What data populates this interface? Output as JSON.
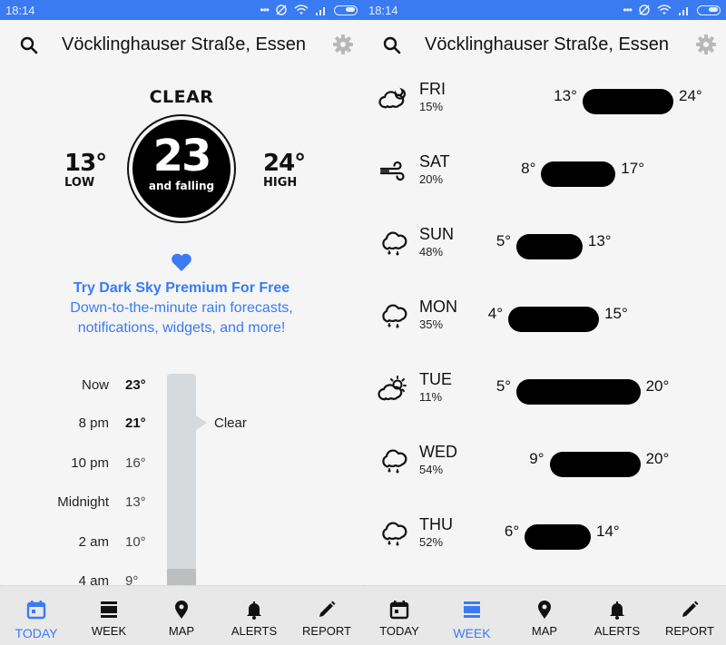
{
  "status_bar": {
    "time": "18:14",
    "color": "#3a7bf2"
  },
  "header": {
    "location": "Vöcklinghauser Straße, Essen",
    "search_icon": "search-icon",
    "settings_icon": "gear-icon"
  },
  "today": {
    "condition": "CLEAR",
    "current_temp": "23",
    "trend": "and falling",
    "low": {
      "value": "13°",
      "label": "LOW"
    },
    "high": {
      "value": "24°",
      "label": "HIGH"
    },
    "promo": {
      "icon": "heart-icon",
      "title": "Try Dark Sky Premium For Free",
      "line1": "Down-to-the-minute rain forecasts,",
      "line2": "notifications, widgets, and more!"
    },
    "hourly": [
      {
        "time": "Now",
        "temp": "23°",
        "bold": true
      },
      {
        "time": "8 pm",
        "temp": "21°",
        "bold": true
      },
      {
        "time": "10 pm",
        "temp": "16°",
        "bold": false
      },
      {
        "time": "Midnight",
        "temp": "13°",
        "bold": false
      },
      {
        "time": "2 am",
        "temp": "10°",
        "bold": false
      },
      {
        "time": "4 am",
        "temp": "9°",
        "bold": false
      }
    ],
    "timeline_label": "Clear"
  },
  "week": {
    "days": [
      {
        "day": "FRI",
        "precip": "15%",
        "low": 13,
        "high": 24,
        "low_label": "13°",
        "high_label": "24°",
        "icon": "partly-cloudy-night-icon"
      },
      {
        "day": "SAT",
        "precip": "20%",
        "low": 8,
        "high": 17,
        "low_label": "8°",
        "high_label": "17°",
        "icon": "wind-icon"
      },
      {
        "day": "SUN",
        "precip": "48%",
        "low": 5,
        "high": 13,
        "low_label": "5°",
        "high_label": "13°",
        "icon": "rain-icon"
      },
      {
        "day": "MON",
        "precip": "35%",
        "low": 4,
        "high": 15,
        "low_label": "4°",
        "high_label": "15°",
        "icon": "rain-icon"
      },
      {
        "day": "TUE",
        "precip": "11%",
        "low": 5,
        "high": 20,
        "low_label": "5°",
        "high_label": "20°",
        "icon": "partly-cloudy-day-icon"
      },
      {
        "day": "WED",
        "precip": "54%",
        "low": 9,
        "high": 20,
        "low_label": "9°",
        "high_label": "20°",
        "icon": "rain-icon"
      },
      {
        "day": "THU",
        "precip": "52%",
        "low": 6,
        "high": 14,
        "low_label": "6°",
        "high_label": "14°",
        "icon": "rain-icon"
      }
    ]
  },
  "tabs": [
    {
      "label": "TODAY",
      "icon": "calendar-icon"
    },
    {
      "label": "WEEK",
      "icon": "week-list-icon"
    },
    {
      "label": "MAP",
      "icon": "map-pin-icon"
    },
    {
      "label": "ALERTS",
      "icon": "bell-icon"
    },
    {
      "label": "REPORT",
      "icon": "pencil-icon"
    }
  ],
  "colors": {
    "accent": "#3a7bf2",
    "timeline": "#d6dadd",
    "tabbar": "#e8e8e8"
  }
}
